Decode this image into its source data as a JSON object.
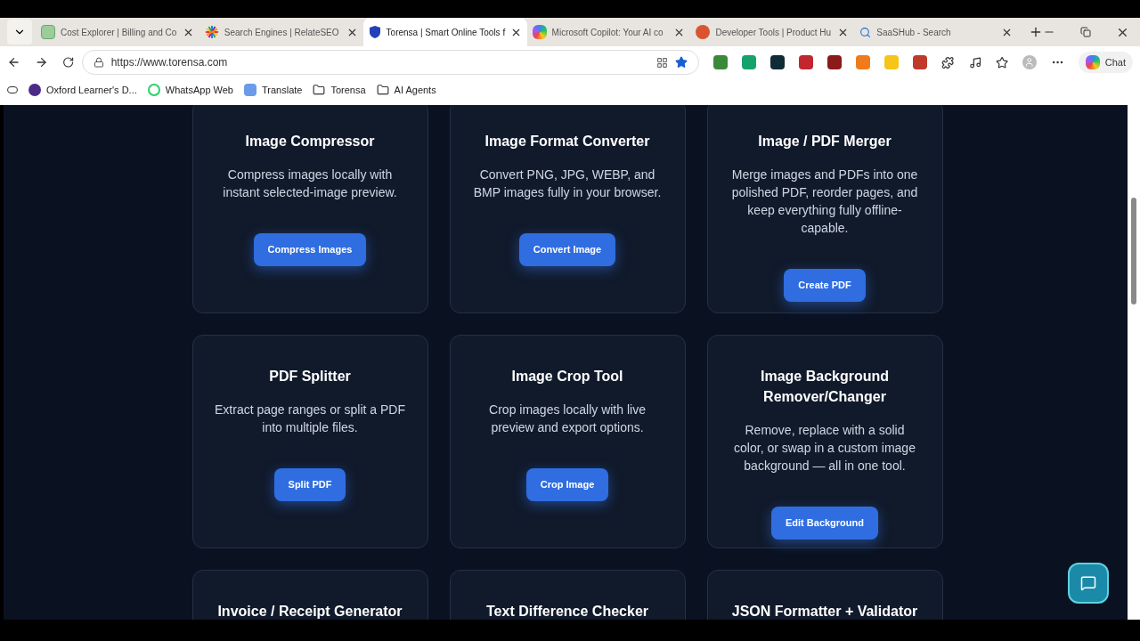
{
  "tabs": [
    {
      "title": "Cost Explorer | Billing and Co",
      "selected": false
    },
    {
      "title": "Search Engines | RelateSEO",
      "selected": false
    },
    {
      "title": "Torensa | Smart Online Tools f",
      "selected": true
    },
    {
      "title": "Microsoft Copilot: Your AI co",
      "selected": false
    },
    {
      "title": "Developer Tools | Product Hu",
      "selected": false
    },
    {
      "title": "SaaSHub - Search",
      "selected": false
    }
  ],
  "address_bar": {
    "url": "https://www.torensa.com"
  },
  "toolbar": {
    "chat_label": "Chat"
  },
  "bookmarks": [
    {
      "label": "Oxford Learner's D..."
    },
    {
      "label": "WhatsApp Web"
    },
    {
      "label": "Translate"
    },
    {
      "label": "Torensa"
    },
    {
      "label": "AI Agents"
    }
  ],
  "tool_cards": [
    {
      "title": "Image Compressor",
      "description": "Compress images locally with instant selected-image preview.",
      "button": "Compress Images"
    },
    {
      "title": "Image Format Converter",
      "description": "Convert PNG, JPG, WEBP, and BMP images fully in your browser.",
      "button": "Convert Image"
    },
    {
      "title": "Image / PDF Merger",
      "description": "Merge images and PDFs into one polished PDF, reorder pages, and keep everything fully offline-capable.",
      "button": "Create PDF"
    },
    {
      "title": "PDF Splitter",
      "description": "Extract page ranges or split a PDF into multiple files.",
      "button": "Split PDF"
    },
    {
      "title": "Image Crop Tool",
      "description": "Crop images locally with live preview and export options.",
      "button": "Crop Image"
    },
    {
      "title": "Image Background Remover/Changer",
      "description": "Remove, replace with a solid color, or swap in a custom image background — all in one tool.",
      "button": "Edit Background"
    },
    {
      "title": "Invoice / Receipt Generator"
    },
    {
      "title": "Text Difference Checker"
    },
    {
      "title": "JSON Formatter + Validator"
    }
  ]
}
